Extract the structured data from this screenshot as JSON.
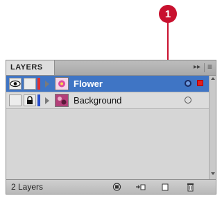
{
  "callout": {
    "number": "1",
    "color": "#c8102e"
  },
  "panel": {
    "tab_label": "LAYERS",
    "tab_controls": {
      "expand_glyph": "▸▸",
      "menu_glyph": "≡"
    }
  },
  "layers": [
    {
      "name": "Flower",
      "visible": true,
      "locked": false,
      "selected": true,
      "color": "#e03030",
      "targeted": true
    },
    {
      "name": "Background",
      "visible": false,
      "locked": true,
      "selected": false,
      "color": "#2850d0",
      "targeted": false
    }
  ],
  "footer": {
    "count_label": "2 Layers",
    "buttons": [
      "make-clipping-mask-icon",
      "create-sublayer-icon",
      "create-new-layer-icon",
      "delete-layer-icon"
    ]
  },
  "colors": {
    "selection": "#3f75c5",
    "accent": "#c8102e"
  }
}
